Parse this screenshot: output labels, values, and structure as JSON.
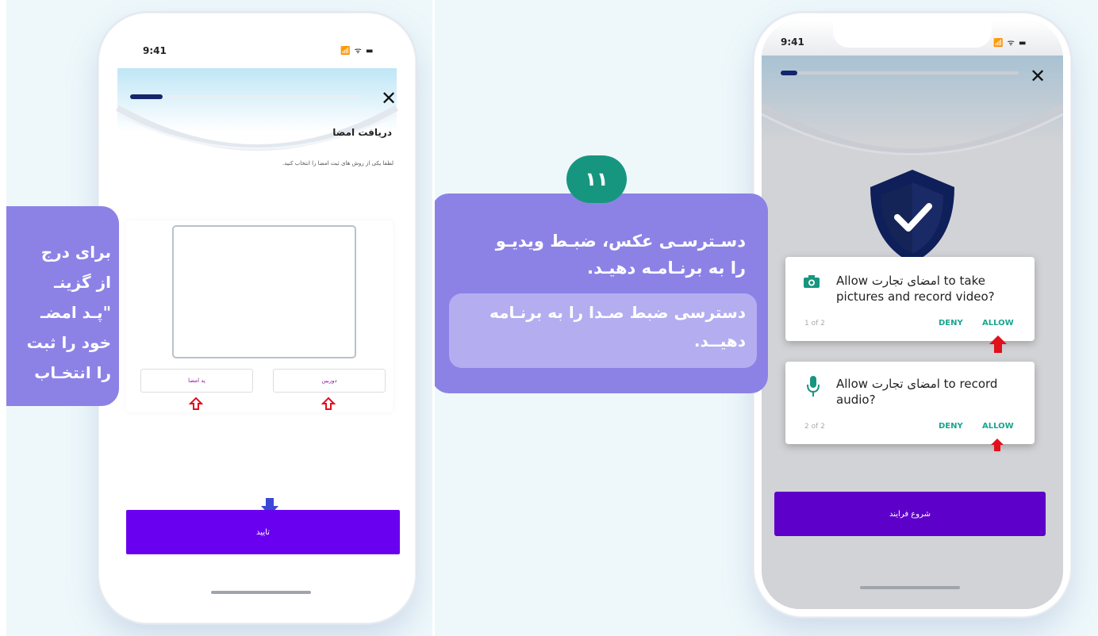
{
  "left_phone": {
    "status_time": "9:41",
    "status_icons": "📶 ᯤ ▬",
    "progress": 0.14,
    "close_icon": "✕",
    "title": "دریافت امضا",
    "subtitle": "لطفا یکی از روش های ثبت امضا را انتخاب کنید.",
    "option_left_label": "پد امضا",
    "option_right_label": "دوربین",
    "confirm_label": "تایید"
  },
  "left_callout": {
    "lines": [
      "برای درج",
      "از گزینـ",
      "\"پـد امضـ",
      "خود را ثبت",
      "را انتخـاب"
    ]
  },
  "middle_callout": {
    "step_number": "۱۱",
    "main_text_line1": "دسـترسـی عکس، ضبـط ویدیـو",
    "main_text_line2": "را به برنـامـه دهیـد.",
    "secondary_text_line1": "دسترسی ضبط صـدا را به برنـامه",
    "secondary_text_line2": "دهیــد."
  },
  "right_phone": {
    "status_time": "9:41",
    "status_icons": "📶 ᯤ ▬",
    "progress": 0.07,
    "close_icon": "✕",
    "dialog1": {
      "message_line1": "Allow امضای تجارت to take",
      "message_line2": "pictures and record video?",
      "count": "1 of 2",
      "deny": "DENY",
      "allow": "ALLOW"
    },
    "dialog2": {
      "message_line1": "Allow امضای تجارت to record",
      "message_line2": "audio?",
      "count": "2 of 2",
      "deny": "DENY",
      "allow": "ALLOW"
    },
    "start_label": "شروع فرایند"
  },
  "colors": {
    "primary_purple": "#6a00f0",
    "callout_purple": "#8c82e6",
    "teal": "#17967f",
    "red_arrow": "#e0101c",
    "blue_arrow": "#3b47d6"
  }
}
